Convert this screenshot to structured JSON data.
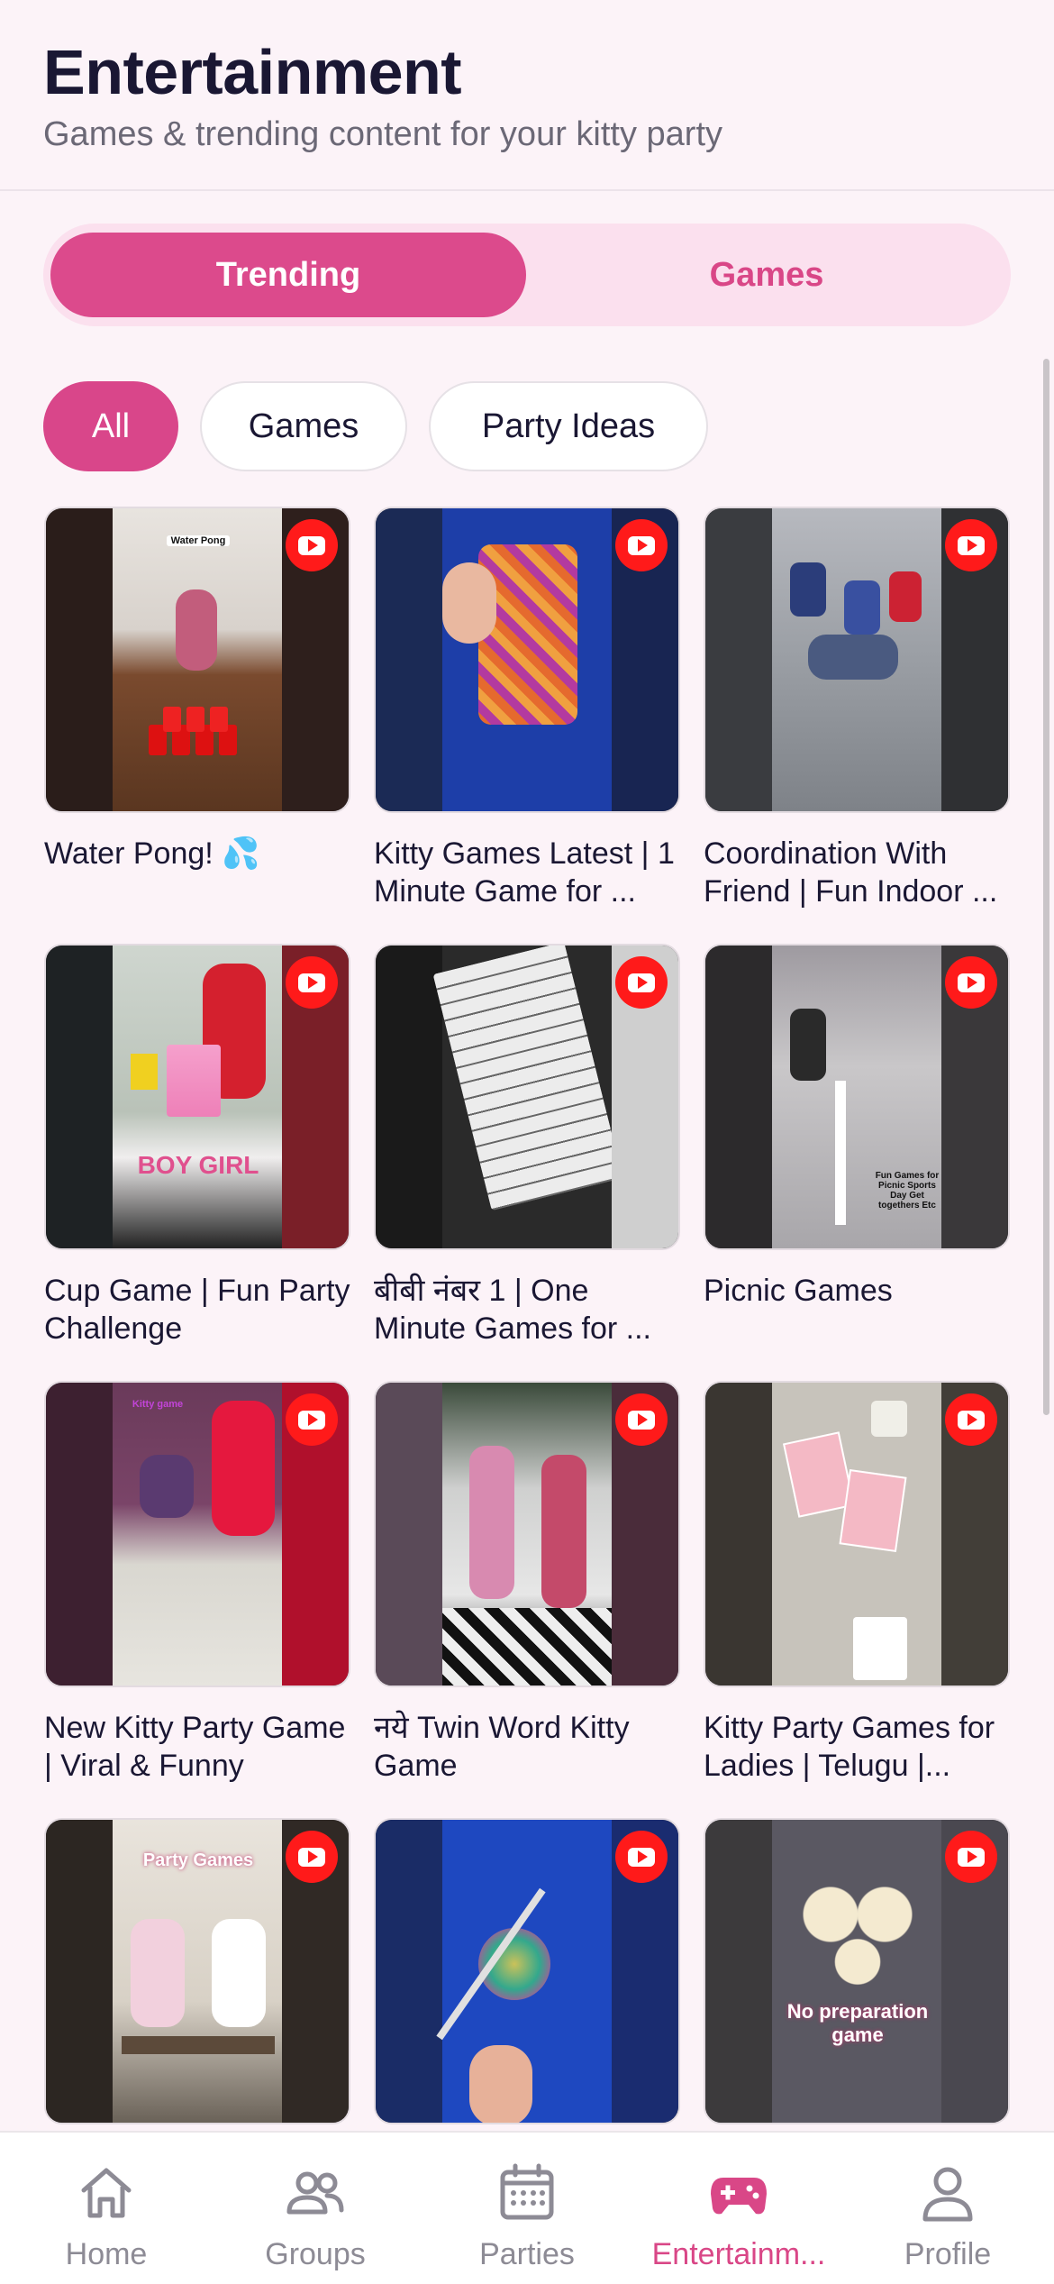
{
  "header": {
    "title": "Entertainment",
    "subtitle": "Games & trending content for your kitty party"
  },
  "segments": [
    {
      "label": "Trending",
      "active": true
    },
    {
      "label": "Games",
      "active": false
    }
  ],
  "filters": [
    {
      "label": "All",
      "active": true
    },
    {
      "label": "Games",
      "active": false
    },
    {
      "label": "Party Ideas",
      "active": false
    }
  ],
  "videos": [
    {
      "title": "Water Pong! 💦",
      "badge": "youtube-icon",
      "overlay": "Water Pong"
    },
    {
      "title": "Kitty Games Latest | 1 Minute Game for ...",
      "badge": "youtube-icon",
      "overlay": ""
    },
    {
      "title": "Coordination With Friend | Fun Indoor ...",
      "badge": "youtube-icon",
      "overlay": ""
    },
    {
      "title": "Cup Game | Fun Party Challenge",
      "badge": "youtube-icon",
      "overlay": "BOY GIRL"
    },
    {
      "title": "बीबी नंबर 1 | One Minute Games for ...",
      "badge": "youtube-icon",
      "overlay": ""
    },
    {
      "title": "Picnic Games",
      "badge": "youtube-icon",
      "overlay": "Fun Games for Picnic Sports Day Get togethers Etc"
    },
    {
      "title": "New Kitty Party Game | Viral & Funny",
      "badge": "youtube-icon",
      "overlay": "Kitty game"
    },
    {
      "title": "नये Twin Word Kitty Game",
      "badge": "youtube-icon",
      "overlay": ""
    },
    {
      "title": "Kitty Party Games for Ladies | Telugu |...",
      "badge": "youtube-icon",
      "overlay": ""
    },
    {
      "title": "",
      "badge": "youtube-icon",
      "overlay": "Party Games"
    },
    {
      "title": "",
      "badge": "youtube-icon",
      "overlay": ""
    },
    {
      "title": "",
      "badge": "youtube-icon",
      "overlay": "No preparation game"
    }
  ],
  "tabbar": [
    {
      "label": "Home",
      "icon": "home-icon",
      "active": false
    },
    {
      "label": "Groups",
      "icon": "groups-icon",
      "active": false
    },
    {
      "label": "Parties",
      "icon": "calendar-icon",
      "active": false
    },
    {
      "label": "Entertainm...",
      "icon": "gamepad-icon",
      "active": true
    },
    {
      "label": "Profile",
      "icon": "person-icon",
      "active": false
    }
  ],
  "colors": {
    "accent": "#d9468a",
    "background": "#fcf3f8",
    "youtube": "#ff1a1a"
  }
}
